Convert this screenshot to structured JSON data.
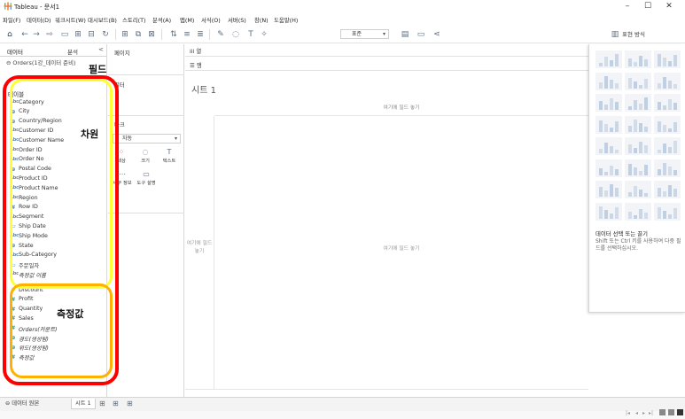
{
  "window": {
    "title": "Tableau - 문서1",
    "minimize": "–",
    "maximize": "☐",
    "close": "✕"
  },
  "menu": [
    "파일(F)",
    "데이터(D)",
    "워크시트(W)",
    "대시보드(B)",
    "스토리(T)",
    "분석(A)",
    "맵(M)",
    "서식(O)",
    "서버(S)",
    "창(N)",
    "도움말(H)"
  ],
  "toolbar": {
    "fit": "표준",
    "show_me": "표현 방식"
  },
  "data_pane": {
    "tab_data": "데이터",
    "tab_analysis": "분석",
    "close": "<",
    "datasource": "Orders(1강_데이터 준비)",
    "tables_label": "테이블",
    "dimensions": [
      {
        "name": "Category",
        "icon": "Abc",
        "kind": "string"
      },
      {
        "name": "City",
        "icon": "⊕",
        "kind": "geo"
      },
      {
        "name": "Country/Region",
        "icon": "⊕",
        "kind": "geo"
      },
      {
        "name": "Customer ID",
        "icon": "Abc",
        "kind": "string"
      },
      {
        "name": "Customer Name",
        "icon": "Abc",
        "kind": "string"
      },
      {
        "name": "Order ID",
        "icon": "Abc",
        "kind": "string"
      },
      {
        "name": "Order No",
        "icon": "Abc",
        "kind": "string"
      },
      {
        "name": "Postal Code",
        "icon": "⊕",
        "kind": "geo"
      },
      {
        "name": "Product ID",
        "icon": "Abc",
        "kind": "string"
      },
      {
        "name": "Product Name",
        "icon": "Abc",
        "kind": "string"
      },
      {
        "name": "Region",
        "icon": "Abc",
        "kind": "string"
      },
      {
        "name": "Row ID",
        "icon": "#",
        "kind": "number"
      },
      {
        "name": "Segment",
        "icon": "Abc",
        "kind": "string"
      },
      {
        "name": "Ship Date",
        "icon": "▭",
        "kind": "date"
      },
      {
        "name": "Ship Mode",
        "icon": "Abc",
        "kind": "string"
      },
      {
        "name": "State",
        "icon": "⊕",
        "kind": "geo"
      },
      {
        "name": "Sub-Category",
        "icon": "Abc",
        "kind": "string"
      },
      {
        "name": "주문일자",
        "icon": "▭",
        "kind": "date"
      },
      {
        "name": "측정값 이름",
        "icon": "Abc",
        "kind": "string",
        "italic": true
      }
    ],
    "measures": [
      {
        "name": "Discount",
        "icon": "#",
        "kind": "number"
      },
      {
        "name": "Profit",
        "icon": "#",
        "kind": "number"
      },
      {
        "name": "Quantity",
        "icon": "#",
        "kind": "number"
      },
      {
        "name": "Sales",
        "icon": "#",
        "kind": "number"
      },
      {
        "name": "Orders(카운트)",
        "icon": "#",
        "kind": "number",
        "italic": true
      },
      {
        "name": "경도(생성됨)",
        "icon": "⊕",
        "kind": "geo",
        "italic": true
      },
      {
        "name": "위도(생성됨)",
        "icon": "⊕",
        "kind": "geo",
        "italic": true
      },
      {
        "name": "측정값",
        "icon": "#",
        "kind": "number",
        "italic": true
      }
    ]
  },
  "cards": {
    "pages": "페이지",
    "filters": "필터",
    "marks": "마크",
    "mark_type": "자동",
    "buttons": [
      {
        "label": "색상",
        "icon": "⁘"
      },
      {
        "label": "크기",
        "icon": "◌"
      },
      {
        "label": "텍스트",
        "icon": "T"
      },
      {
        "label": "세부 정보",
        "icon": "⋯"
      },
      {
        "label": "도구 설명",
        "icon": "▭"
      }
    ]
  },
  "shelves": {
    "columns": "열",
    "rows": "행"
  },
  "canvas": {
    "sheet_title": "시트 1",
    "drop_top": "여기에 필드 놓기",
    "drop_left": "여기에 필드 놓기",
    "drop_center": "여기에 필드 놓기"
  },
  "show_me": {
    "heading": "데이터 선택 또는 끌기",
    "hint": "Shift 또는 Ctrl 키를 사용하여 다중 필드를 선택하십시오."
  },
  "statusbar": {
    "datasource_tab": "데이터 원본",
    "sheet_tab": "시트 1"
  },
  "annotations": {
    "fields": "필드",
    "dimensions": "차원",
    "measures": "측정값"
  },
  "colors": {
    "annotation_red": "#ff0000",
    "annotation_yellow": "#ffff33",
    "annotation_orange": "#ffb000",
    "dimension_icon": "#4f81bd",
    "measure_icon": "#3e9a6a"
  }
}
